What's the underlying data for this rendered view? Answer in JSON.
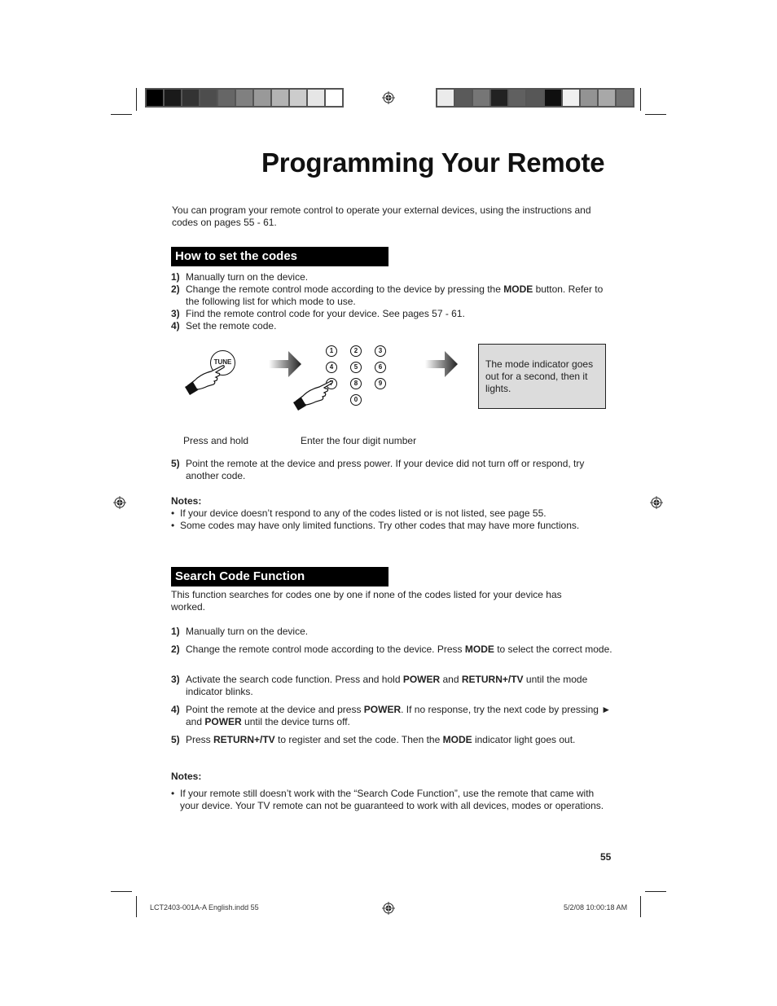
{
  "page": {
    "title": "Programming Your Remote",
    "intro": "You can program your remote control to operate your external devices, using the instructions and codes on pages 55 - 61.",
    "page_number": "55"
  },
  "print_marks": {
    "left_colorbar": [
      "#000000",
      "#1a1a1a",
      "#333333",
      "#4d4d4d",
      "#666666",
      "#808080",
      "#999999",
      "#b3b3b3",
      "#cccccc",
      "#e6e6e6",
      "#ffffff"
    ],
    "right_colorbar": [
      "#ebebeb",
      "#5a5a5a",
      "#767676",
      "#222222",
      "#606060",
      "#575757",
      "#0f0f0f",
      "#f0f0f0",
      "#939393",
      "#a8a8a8",
      "#707070"
    ]
  },
  "how_to_set": {
    "heading": "How to set the codes",
    "steps": [
      {
        "num": "1)",
        "parts": [
          {
            "t": "Manually turn on the device."
          }
        ]
      },
      {
        "num": "2)",
        "parts": [
          {
            "t": "Change the remote control mode according to the device by pressing the "
          },
          {
            "b": "MODE"
          },
          {
            "t": " button. Refer to the following list for which mode to use."
          }
        ]
      },
      {
        "num": "3)",
        "parts": [
          {
            "t": "Find the remote control code for your device.  See pages 57 - 61."
          }
        ]
      },
      {
        "num": "4)",
        "parts": [
          {
            "t": "Set the remote code."
          }
        ]
      }
    ],
    "diagram": {
      "tune_label": "TUNE",
      "keypad": [
        "1",
        "2",
        "3",
        "4",
        "5",
        "6",
        "7",
        "8",
        "9",
        "0"
      ],
      "info_box": "The mode indicator goes out for a second, then it lights.",
      "caption_press": "Press and hold",
      "caption_enter": "Enter the four digit number"
    },
    "step5": {
      "num": "5)",
      "parts": [
        {
          "t": "Point the remote at the device and press power.  If your device did not turn off or respond, try another code."
        }
      ]
    },
    "notes_label": "Notes:",
    "notes": [
      "If your device doesn’t respond to any of the codes listed or is not listed, see page 55.",
      "Some codes may have only limited functions.  Try other codes that may have more functions."
    ]
  },
  "search_code": {
    "heading": "Search Code Function",
    "intro": "This function searches for codes one by one if none of the codes listed for your device has worked.",
    "steps": [
      {
        "num": "1)",
        "parts": [
          {
            "t": "Manually turn on the device."
          }
        ]
      },
      {
        "num": "2)",
        "parts": [
          {
            "t": "Change the remote control mode according to the device.  Press "
          },
          {
            "b": "MODE"
          },
          {
            "t": " to select the correct mode."
          }
        ]
      },
      {
        "num": "3)",
        "parts": [
          {
            "t": "Activate the search code function.  Press and hold "
          },
          {
            "b": "POWER"
          },
          {
            "t": " and "
          },
          {
            "b": "RETURN+/TV"
          },
          {
            "t": " until the mode indicator blinks."
          }
        ]
      },
      {
        "num": "4)",
        "parts": [
          {
            "t": "Point the remote at the device and press "
          },
          {
            "b": "POWER"
          },
          {
            "t": ".  If no response, try the next code by pressing ► and "
          },
          {
            "b": "POWER"
          },
          {
            "t": " until the device turns off."
          }
        ]
      },
      {
        "num": "5)",
        "parts": [
          {
            "t": "Press "
          },
          {
            "b": "RETURN+/TV"
          },
          {
            "t": " to register and set the code.  Then the "
          },
          {
            "b": "MODE"
          },
          {
            "t": " indicator light goes out."
          }
        ]
      }
    ],
    "notes_label": "Notes:",
    "notes": [
      "If your remote still doesn’t work with the “Search Code Function”, use the remote that came with your device.  Your TV remote can not be guaranteed to work with all devices, modes or operations."
    ]
  },
  "footer": {
    "file": "LCT2403-001A-A English.indd   55",
    "timestamp": "5/2/08   10:00:18 AM"
  }
}
